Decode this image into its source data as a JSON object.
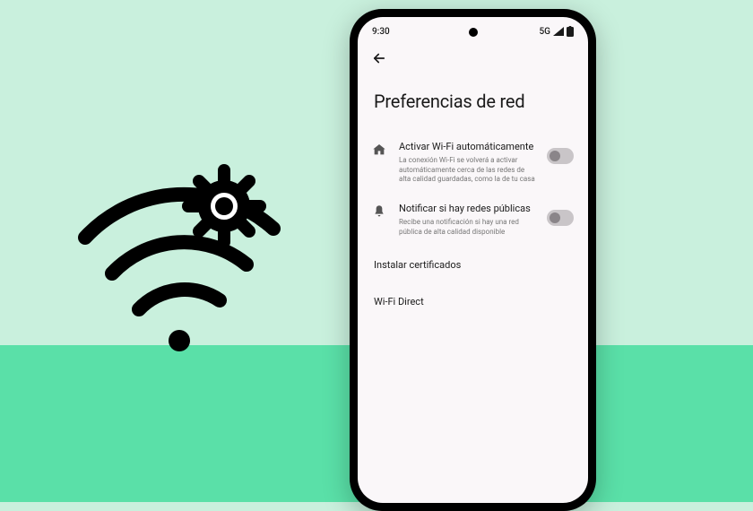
{
  "statusBar": {
    "time": "9:30",
    "network": "5G"
  },
  "page": {
    "title": "Preferencias de red"
  },
  "settings": {
    "autoWifi": {
      "title": "Activar Wi-Fi automáticamente",
      "description": "La conexión Wi-Fi se volverá a activar automáticamente cerca de las redes de alta calidad guardadas, como la de tu casa",
      "enabled": false
    },
    "publicNotify": {
      "title": "Notificar si hay redes públicas",
      "description": "Recibe una notificación si hay una red pública de alta calidad disponible",
      "enabled": false
    },
    "installCerts": {
      "label": "Instalar certificados"
    },
    "wifiDirect": {
      "label": "Wi-Fi Direct"
    }
  }
}
